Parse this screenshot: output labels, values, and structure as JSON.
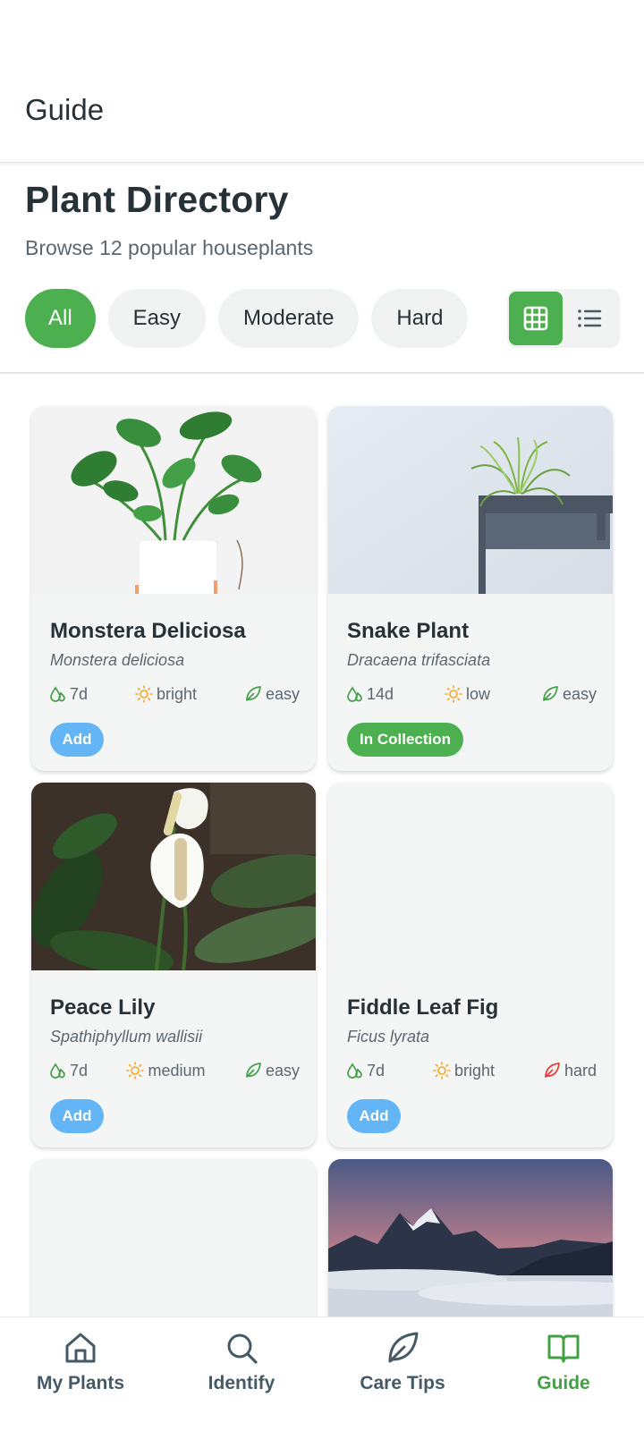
{
  "appbar": {
    "title": "Guide"
  },
  "page": {
    "heading": "Plant Directory",
    "subheading": "Browse 12 popular houseplants"
  },
  "filters": [
    "All",
    "Easy",
    "Moderate",
    "Hard"
  ],
  "view_toggle": {
    "icons": [
      "grid-icon",
      "list-icon"
    ],
    "selected": "grid"
  },
  "colors": {
    "accent": "#4caf50",
    "add_button": "#64b5f6",
    "difficulty_easy": "#43a047",
    "difficulty_hard": "#e53935",
    "sun": "#f5a623"
  },
  "plants": [
    {
      "name": "Monstera Deliciosa",
      "scientific": "Monstera deliciosa",
      "water": "7d",
      "light": "bright",
      "difficulty": "easy",
      "action": "Add"
    },
    {
      "name": "Snake Plant",
      "scientific": "Dracaena trifasciata",
      "water": "14d",
      "light": "low",
      "difficulty": "easy",
      "action": "In Collection"
    },
    {
      "name": "Peace Lily",
      "scientific": "Spathiphyllum wallisii",
      "water": "7d",
      "light": "medium",
      "difficulty": "easy",
      "action": "Add"
    },
    {
      "name": "Fiddle Leaf Fig",
      "scientific": "Ficus lyrata",
      "water": "7d",
      "light": "bright",
      "difficulty": "hard",
      "action": "Add"
    }
  ],
  "bottom_nav": [
    {
      "label": "My Plants",
      "icon": "home-icon"
    },
    {
      "label": "Identify",
      "icon": "search-icon"
    },
    {
      "label": "Care Tips",
      "icon": "leaf-icon"
    },
    {
      "label": "Guide",
      "icon": "book-icon",
      "active": true
    }
  ]
}
